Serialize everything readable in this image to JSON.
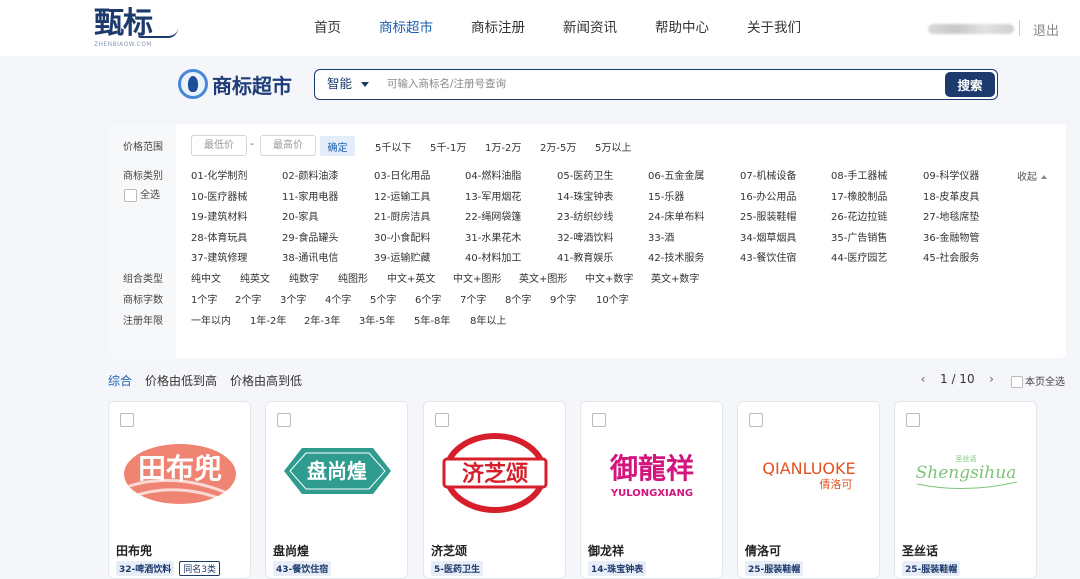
{
  "header": {
    "logo_text": "甄标",
    "logo_sub": "ZHENBIAOW.COM",
    "nav": [
      "首页",
      "商标超市",
      "商标注册",
      "新闻资讯",
      "帮助中心",
      "关于我们"
    ],
    "active_nav": "商标超市",
    "logout": "退出"
  },
  "search": {
    "brand_title": "商标超市",
    "type": "智能",
    "placeholder": "可输入商标名/注册号查询",
    "button": "搜索"
  },
  "filters": {
    "price": {
      "label": "价格范围",
      "min_placeholder": "最低价",
      "max_placeholder": "最高价",
      "dash": "-",
      "confirm": "确定",
      "options": [
        "5千以下",
        "5千-1万",
        "1万-2万",
        "2万-5万",
        "5万以上"
      ]
    },
    "category": {
      "label": "商标类别",
      "select_all": "全选",
      "collapse": "收起",
      "items": [
        "01-化学制剂",
        "02-颜料油漆",
        "03-日化用品",
        "04-燃料油脂",
        "05-医药卫生",
        "06-五金金属",
        "07-机械设备",
        "08-手工器械",
        "09-科学仪器",
        "10-医疗器械",
        "11-家用电器",
        "12-运输工具",
        "13-军用烟花",
        "14-珠宝钟表",
        "15-乐器",
        "16-办公用品",
        "17-橡胶制品",
        "18-皮革皮具",
        "19-建筑材料",
        "20-家具",
        "21-厨房洁具",
        "22-绳网袋篷",
        "23-纺织纱线",
        "24-床单布料",
        "25-服装鞋帽",
        "26-花边拉链",
        "27-地毯席垫",
        "28-体育玩具",
        "29-食品罐头",
        "30-小食配料",
        "31-水果花木",
        "32-啤酒饮料",
        "33-酒",
        "34-烟草烟具",
        "35-广告销售",
        "36-金融物管",
        "37-建筑修理",
        "38-通讯电信",
        "39-运输贮藏",
        "40-材料加工",
        "41-教育娱乐",
        "42-技术服务",
        "43-餐饮住宿",
        "44-医疗园艺",
        "45-社会服务"
      ]
    },
    "combo": {
      "label": "组合类型",
      "options": [
        "纯中文",
        "纯英文",
        "纯数字",
        "纯图形",
        "中文+英文",
        "中文+图形",
        "英文+图形",
        "中文+数字",
        "英文+数字"
      ]
    },
    "chars": {
      "label": "商标字数",
      "options": [
        "1个字",
        "2个字",
        "3个字",
        "4个字",
        "5个字",
        "6个字",
        "7个字",
        "8个字",
        "9个字",
        "10个字"
      ]
    },
    "years": {
      "label": "注册年限",
      "options": [
        "一年以内",
        "1年-2年",
        "2年-3年",
        "3年-5年",
        "5年-8年",
        "8年以上"
      ]
    }
  },
  "sort": {
    "options": [
      "综合",
      "价格由低到高",
      "价格由高到低"
    ],
    "active": "综合"
  },
  "pager": {
    "prev": "‹",
    "next": "›",
    "current": "1 / 10",
    "select_page": "本页全选"
  },
  "cards": [
    {
      "name": "田布兜",
      "logo_text": "田布兜",
      "tags": [
        "32-啤酒饮料",
        "同名3类"
      ]
    },
    {
      "name": "盘尚煌",
      "logo_text": "盘尚煌",
      "tags": [
        "43-餐饮住宿"
      ]
    },
    {
      "name": "济芝颂",
      "logo_text": "济芝颂",
      "tags": [
        "5-医药卫生"
      ]
    },
    {
      "name": "御龙祥",
      "logo_text": "御龍祥",
      "logo_sub": "YULONGXIANG",
      "tags": [
        "14-珠宝钟表"
      ]
    },
    {
      "name": "倩洛可",
      "logo_text": "QIANLUOKE",
      "logo_sub": "倩洛可",
      "tags": [
        "25-服装鞋帽"
      ]
    },
    {
      "name": "圣丝话",
      "logo_text": "Shengsihua",
      "logo_sub": "圣丝话",
      "tags": [
        "25-服装鞋帽"
      ]
    }
  ],
  "colors": {
    "primary": "#1d3a6c",
    "accent": "#1e5fb0",
    "logo_red": "#d71f2b",
    "logo_teal": "#2f9c8f",
    "logo_salmon": "#f08472",
    "logo_pink": "#d4147f",
    "logo_orange": "#e2531f",
    "logo_green": "#7cc37a"
  }
}
